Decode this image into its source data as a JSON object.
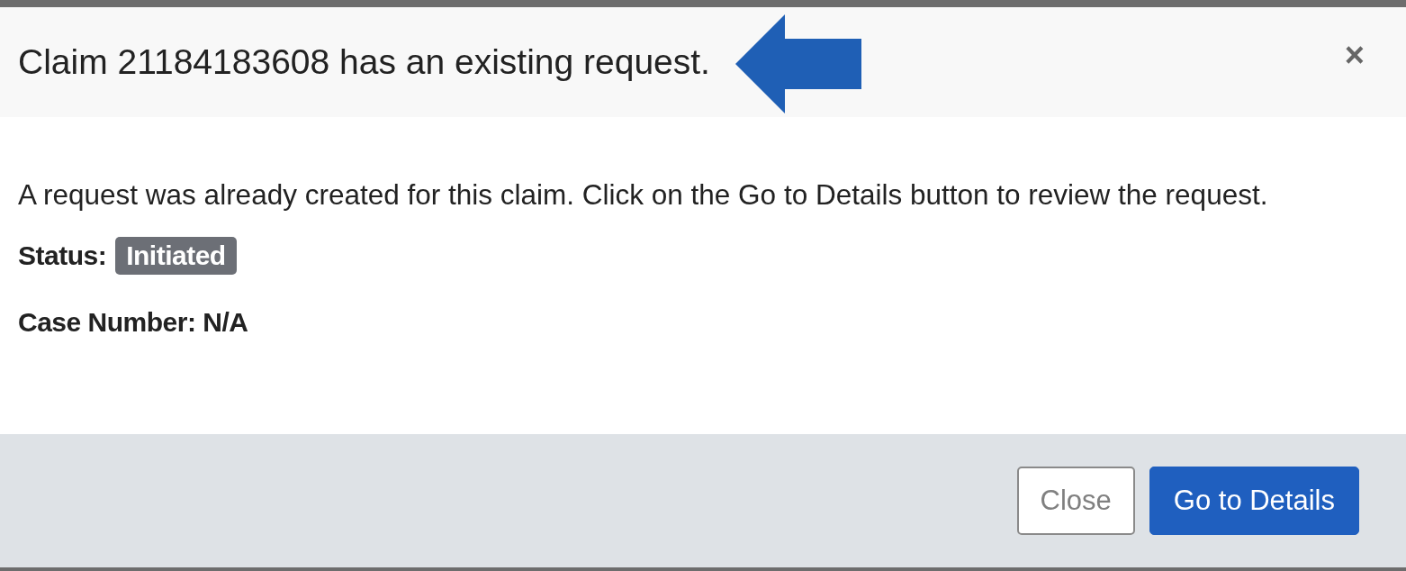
{
  "dialog": {
    "title": "Claim 21184183608 has an existing request.",
    "close_glyph": "×",
    "message": "A request was already created for this claim. Click on the Go to Details button to review the request.",
    "status": {
      "label": "Status:",
      "value": "Initiated"
    },
    "case_number": "Case Number: N/A",
    "buttons": [
      {
        "label": "Close",
        "kind": "secondary"
      },
      {
        "label": "Go to Details",
        "kind": "primary"
      }
    ]
  }
}
